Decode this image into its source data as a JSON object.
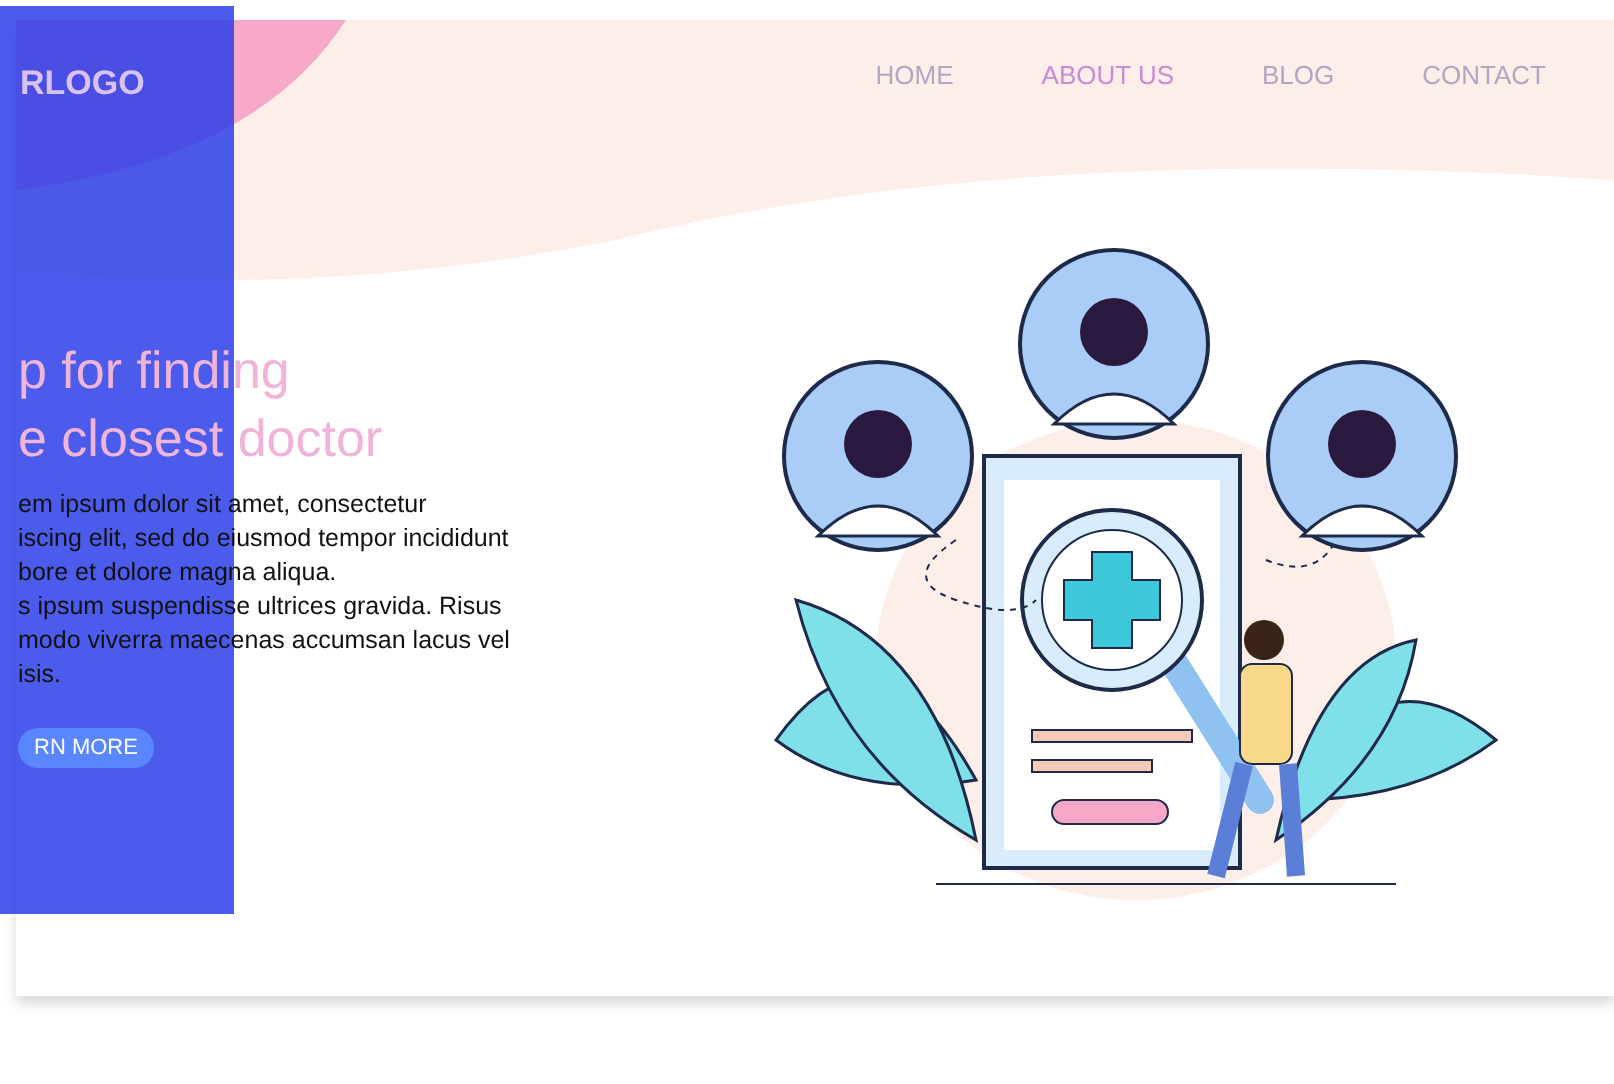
{
  "logo": "RLOGO",
  "nav": [
    {
      "label": "HOME",
      "selected": false
    },
    {
      "label": "ABOUT US",
      "selected": true
    },
    {
      "label": "BLOG",
      "selected": false
    },
    {
      "label": "CONTACT",
      "selected": false
    }
  ],
  "hero": {
    "title_lines": [
      "p for finding",
      "e closest doctor"
    ],
    "body_lines": [
      "em ipsum dolor sit amet, consectetur",
      "iscing elit, sed do eiusmod tempor incididunt",
      "bore et dolore magna aliqua.",
      "s ipsum suspendisse ultrices gravida. Risus",
      "modo viverra maecenas accumsan lacus vel",
      "isis."
    ],
    "button": "RN MORE"
  }
}
